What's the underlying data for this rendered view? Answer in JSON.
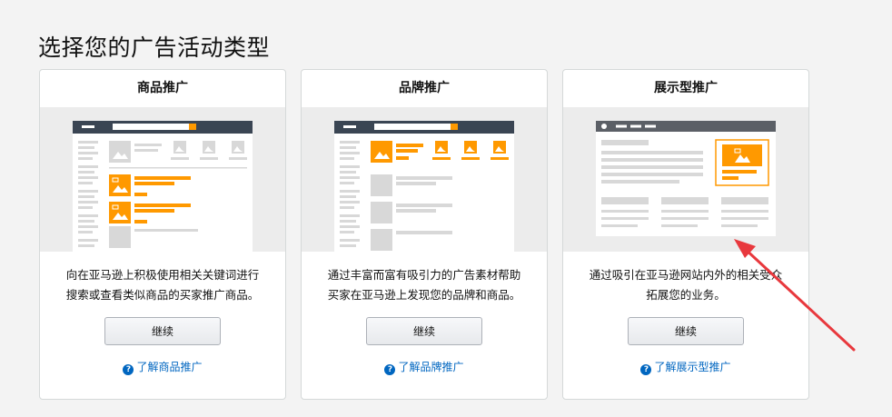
{
  "page": {
    "title": "选择您的广告活动类型"
  },
  "cards": [
    {
      "title": "商品推广",
      "description_line1": "向在亚马逊上积极使用相关关键词进行",
      "description_line2": "搜索或查看类似商品的买家推广商品。",
      "button_label": "继续",
      "learn_more": "了解商品推广"
    },
    {
      "title": "品牌推广",
      "description_line1": "通过丰富而富有吸引力的广告素材帮助",
      "description_line2": "买家在亚马逊上发现您的品牌和商品。",
      "button_label": "继续",
      "learn_more": "了解品牌推广"
    },
    {
      "title": "展示型推广",
      "description_line1": "通过吸引在亚马逊网站内外的相关受众",
      "description_line2": "拓展您的业务。",
      "button_label": "继续",
      "learn_more": "了解展示型推广"
    }
  ],
  "help_icon_glyph": "?",
  "colors": {
    "accent": "#ff9900",
    "link": "#0066c0",
    "annotation_arrow": "#e8383d"
  }
}
